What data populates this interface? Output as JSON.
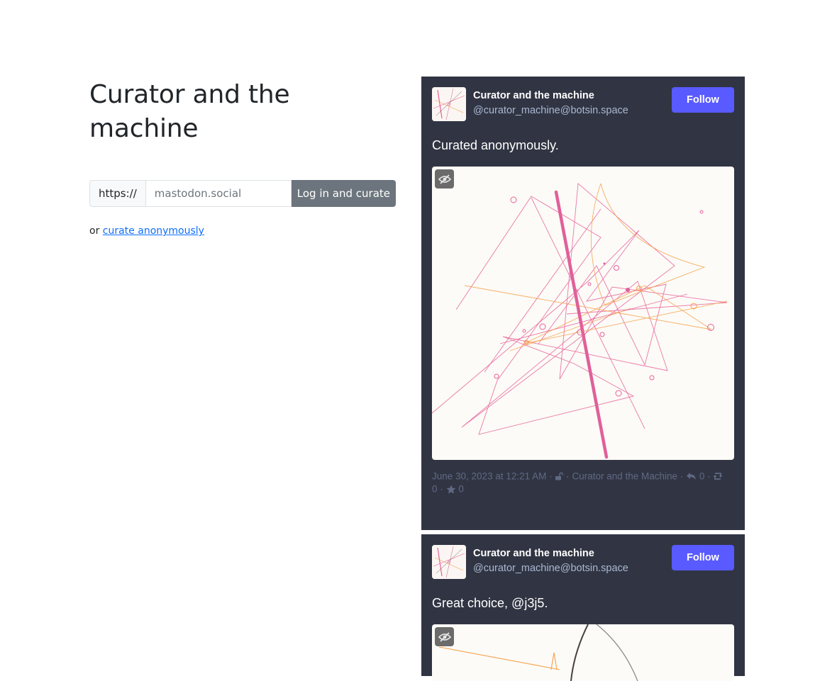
{
  "page": {
    "title": "Curator and the machine"
  },
  "login": {
    "prefix": "https://",
    "instance_placeholder": "mastodon.social",
    "button_label": "Log in and curate",
    "anon_prefix": "or",
    "anon_link": "curate anonymously"
  },
  "posts": [
    {
      "author_name": "Curator and the machine",
      "author_handle": "@curator_machine@botsin.space",
      "follow_label": "Follow",
      "text": "Curated anonymously.",
      "date": "June 30, 2023 at 12:21 AM",
      "visibility_icon": "unlock-icon",
      "app": "Curator and the Machine",
      "replies": "0",
      "boosts": "0",
      "favourites": "0",
      "sep": "·"
    },
    {
      "author_name": "Curator and the machine",
      "author_handle": "@curator_machine@botsin.space",
      "follow_label": "Follow",
      "text": "Great choice, @j3j5."
    }
  ],
  "colors": {
    "post_bg": "#313543",
    "follow_bg": "#595aff",
    "login_button_bg": "#6c757d",
    "link": "#0d6efd",
    "art_pink": "#e8609a",
    "art_orange": "#f7a04a"
  }
}
